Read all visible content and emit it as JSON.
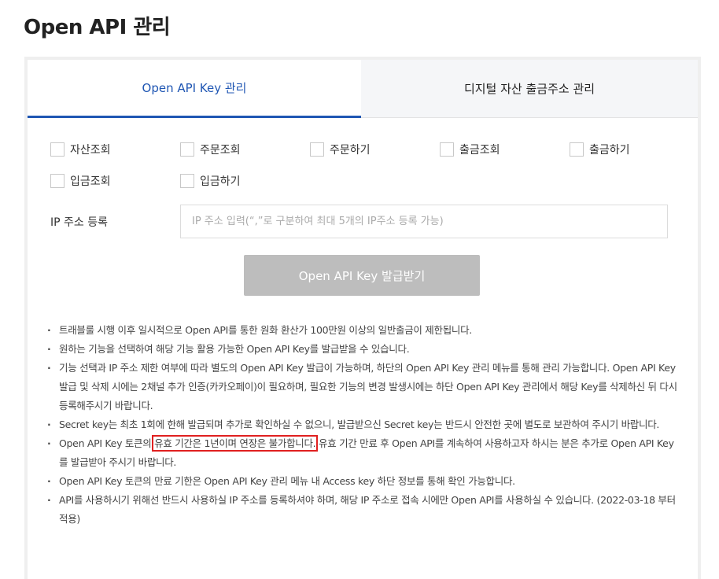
{
  "page": {
    "title": "Open API 관리"
  },
  "tabs": [
    {
      "label": "Open API Key 관리",
      "active": true
    },
    {
      "label": "디지털 자산 출금주소 관리",
      "active": false
    }
  ],
  "permissions": [
    {
      "label": "자산조회",
      "checked": false
    },
    {
      "label": "주문조회",
      "checked": false
    },
    {
      "label": "주문하기",
      "checked": false
    },
    {
      "label": "출금조회",
      "checked": false
    },
    {
      "label": "출금하기",
      "checked": false
    },
    {
      "label": "입금조회",
      "checked": false
    },
    {
      "label": "입금하기",
      "checked": false
    }
  ],
  "ip_registration": {
    "label": "IP 주소 등록",
    "value": "",
    "placeholder": "IP 주소 입력(“,”로 구분하여 최대 5개의 IP주소 등록 가능)"
  },
  "issue_button": {
    "label": "Open API Key 발급받기"
  },
  "notes": [
    "트래블룰 시행 이후 일시적으로 Open API를 통한 원화 환산가 100만원 이상의 일반출금이 제한됩니다.",
    "원하는 기능을 선택하여 해당 기능 활용 가능한 Open API Key를 발급받을 수 있습니다.",
    "기능 선택과 IP 주소 제한 여부에 따라 별도의 Open API Key 발급이 가능하며, 하단의 Open API Key 관리 메뉴를 통해 관리 가능합니다. Open API Key 발급 및 삭제 시에는 2채널 추가 인증(카카오페이)이 필요하며, 필요한 기능의 변경 발생시에는 하단 Open API Key 관리에서 해당 Key를 삭제하신 뒤 다시 등록해주시기 바랍니다.",
    "Secret key는 최초 1회에 한해 발급되며 추가로 확인하실 수 없으니, 발급받으신 Secret key는 반드시 안전한 곳에 별도로 보관하여 주시기 바랍니다.",
    {
      "prefix": "Open API Key 토큰의 ",
      "highlight": "유효 기간은 1년이며 연장은 불가합니다.",
      "suffix": " 유효 기간 만료 후 Open API를 계속하여 사용하고자 하시는 분은 추가로 Open API Key를 발급받아 주시기 바랍니다."
    },
    "Open API Key 토큰의 만료 기한은 Open API Key 관리 메뉴 내 Access key 하단 정보를 통해 확인 가능합니다.",
    "API를 사용하시기 위해선 반드시 사용하실 IP 주소를 등록하셔야 하며, 해당 IP 주소로 접속 시에만 Open API를 사용하실 수 있습니다. (2022-03-18 부터 적용)"
  ],
  "colors": {
    "accent": "#1f56b3",
    "button_disabled": "#bdbdbd",
    "highlight_box": "#e02020"
  }
}
